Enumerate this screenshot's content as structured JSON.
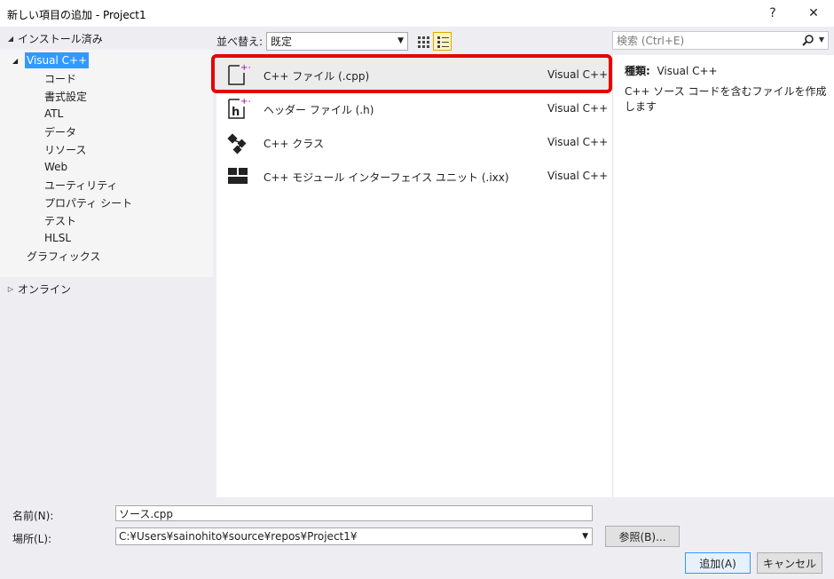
{
  "window": {
    "title": "新しい項目の追加 - Project1",
    "help": "?",
    "close": "✕"
  },
  "left": {
    "installed": "インストール済み",
    "tree": [
      {
        "label": "Visual C++",
        "selected": true
      },
      {
        "label": "コード"
      },
      {
        "label": "書式設定"
      },
      {
        "label": "ATL"
      },
      {
        "label": "データ"
      },
      {
        "label": "リソース"
      },
      {
        "label": "Web"
      },
      {
        "label": "ユーティリティ"
      },
      {
        "label": "プロパティ シート"
      },
      {
        "label": "テスト"
      },
      {
        "label": "HLSL"
      },
      {
        "label": "グラフィックス"
      }
    ],
    "online": "オンライン"
  },
  "toolbar": {
    "sort_label": "並べ替え:",
    "sort_value": "既定"
  },
  "search": {
    "placeholder": "検索 (Ctrl+E)"
  },
  "items": [
    {
      "name": "C++ ファイル (.cpp)",
      "type": "Visual C++",
      "icon": "cpp-file-icon"
    },
    {
      "name": "ヘッダー ファイル (.h)",
      "type": "Visual C++",
      "icon": "header-file-icon"
    },
    {
      "name": "C++ クラス",
      "type": "Visual C++",
      "icon": "class-icon"
    },
    {
      "name": "C++ モジュール インターフェイス ユニット (.ixx)",
      "type": "Visual C++",
      "icon": "module-icon"
    }
  ],
  "details": {
    "kind_label": "種類:",
    "kind_value": "Visual C++",
    "description": "C++ ソース コードを含むファイルを作成します"
  },
  "form": {
    "name_label": "名前(N):",
    "name_value": "ソース.cpp",
    "location_label": "場所(L):",
    "location_value": "C:¥Users¥sainohito¥source¥repos¥Project1¥",
    "browse": "参照(B)...",
    "add": "追加(A)",
    "cancel": "キャンセル"
  },
  "colors": {
    "selection": "#3399ff",
    "highlight": "#e60000",
    "accent_plus": "#b4009e"
  }
}
